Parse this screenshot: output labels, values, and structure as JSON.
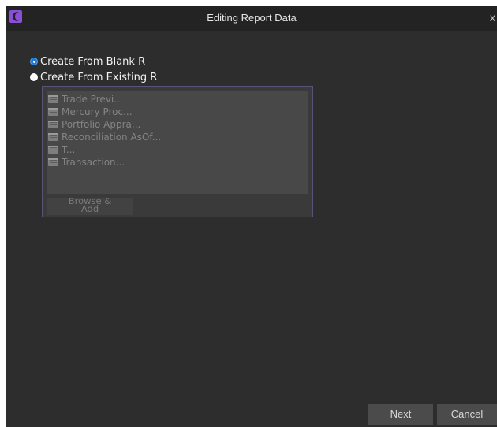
{
  "window": {
    "title": "Editing Report Data",
    "close_label": "x"
  },
  "options": {
    "blank": {
      "label": "Create From Blank R",
      "selected": true
    },
    "existing": {
      "label": "Create From Existing R",
      "selected": false
    }
  },
  "reports": [
    {
      "label": "Trade Previ..."
    },
    {
      "label": "Mercury Proc..."
    },
    {
      "label": "Portfolio Appra..."
    },
    {
      "label": "Reconciliation AsOf..."
    },
    {
      "label": "T..."
    },
    {
      "label": "Transaction..."
    }
  ],
  "browse_button": {
    "line1": "Browse &",
    "line2": "Add"
  },
  "buttons": {
    "next": "Next",
    "cancel": "Cancel"
  },
  "colors": {
    "accent": "#8a4fd6",
    "radio_selected": "#1e78d7",
    "background": "#2d2d2d"
  }
}
